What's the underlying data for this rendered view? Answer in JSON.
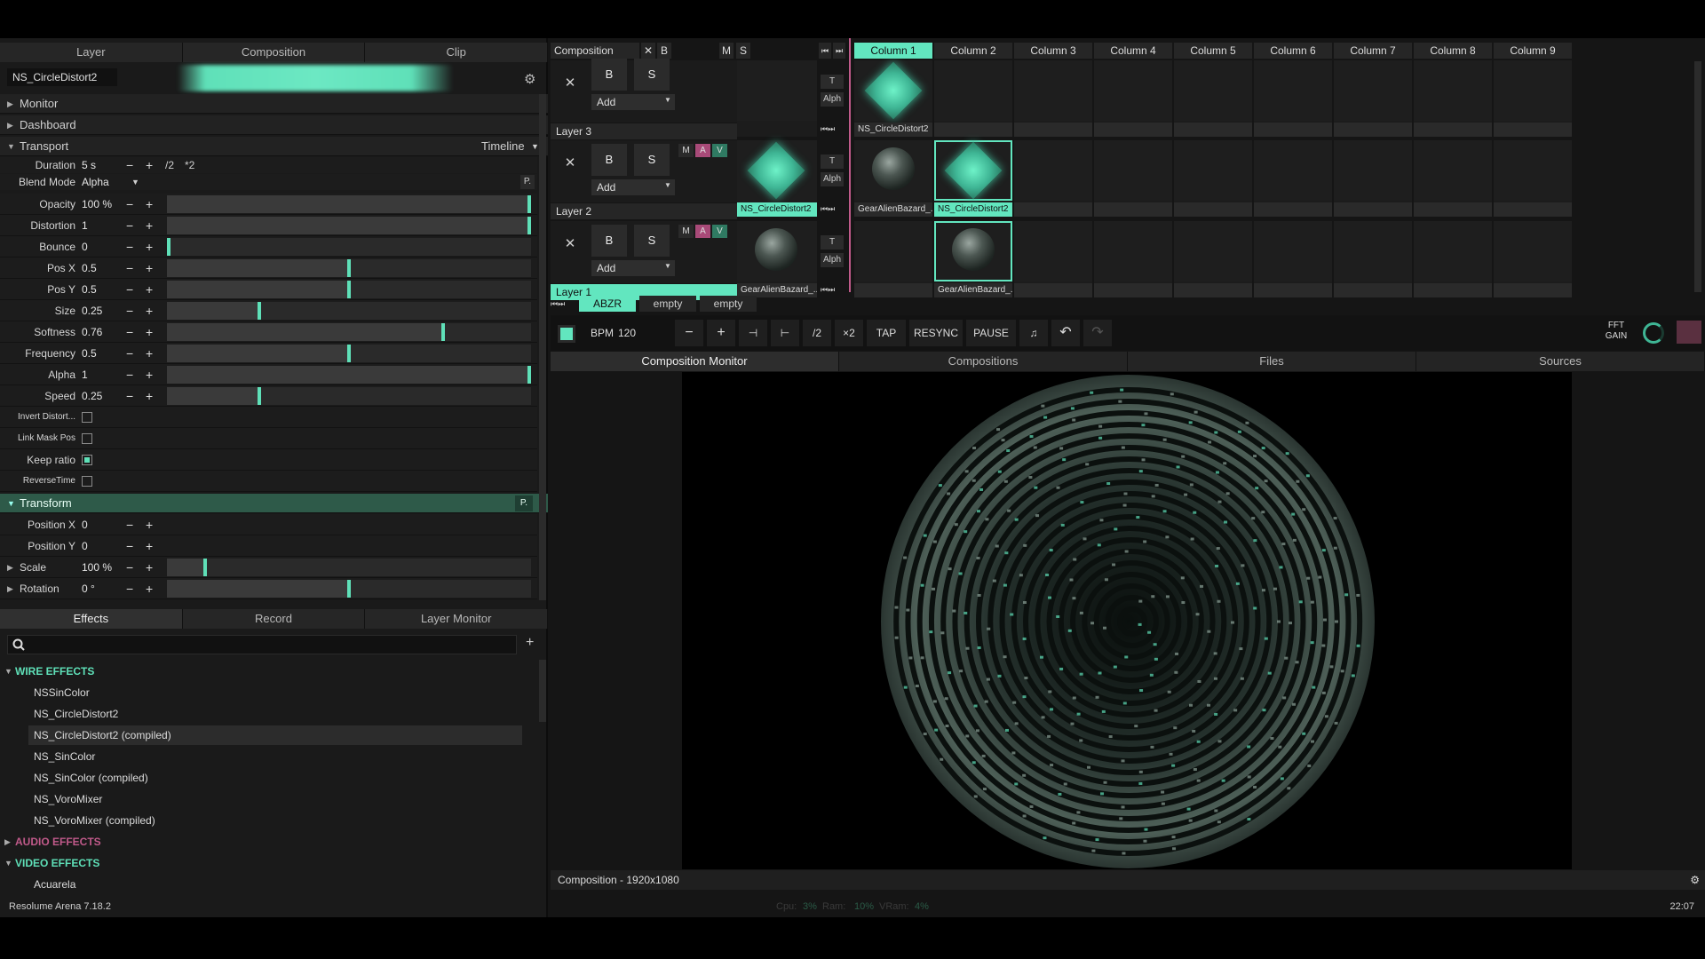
{
  "left_tabs": [
    "Layer",
    "Composition",
    "Clip"
  ],
  "clip_name": "NS_CircleDistort2",
  "sections": {
    "monitor": "Monitor",
    "dashboard": "Dashboard",
    "transport": "Transport",
    "transform": "Transform"
  },
  "transport_mode": "Timeline",
  "transform_p": "P.",
  "blend_p": "P.",
  "duration": {
    "label": "Duration",
    "value": "5 s",
    "minus": "−",
    "plus": "+",
    "half": "/2",
    "double": "*2"
  },
  "blend": {
    "label": "Blend Mode",
    "value": "Alpha"
  },
  "params": [
    {
      "label": "Opacity",
      "value": "100 %",
      "level": 1.0
    },
    {
      "label": "Distortion",
      "value": "1",
      "level": 1.0
    },
    {
      "label": "Bounce",
      "value": "0",
      "level": 0.0
    },
    {
      "label": "Pos X",
      "value": "0.5",
      "level": 0.5
    },
    {
      "label": "Pos Y",
      "value": "0.5",
      "level": 0.5
    },
    {
      "label": "Size",
      "value": "0.25",
      "level": 0.25
    },
    {
      "label": "Softness",
      "value": "0.76",
      "level": 0.76
    },
    {
      "label": "Frequency",
      "value": "0.5",
      "level": 0.5
    },
    {
      "label": "Alpha",
      "value": "1",
      "level": 1.0
    },
    {
      "label": "Speed",
      "value": "0.25",
      "level": 0.25
    }
  ],
  "checks": [
    {
      "label": "Invert Distort...",
      "checked": false
    },
    {
      "label": "Link Mask Pos",
      "checked": false
    },
    {
      "label": "Keep ratio",
      "checked": true
    },
    {
      "label": "ReverseTime",
      "checked": false
    }
  ],
  "transform_params": [
    {
      "label": "Position X",
      "value": "0"
    },
    {
      "label": "Position Y",
      "value": "0"
    },
    {
      "label": "Scale",
      "value": "100 %",
      "level": 0.1
    },
    {
      "label": "Rotation",
      "value": "0 °",
      "level": 0.5
    }
  ],
  "bottom_tabs": [
    "Effects",
    "Record",
    "Layer Monitor"
  ],
  "search_placeholder": "",
  "wire_effects": {
    "title": "WIRE EFFECTS",
    "color": "#5fe0b8",
    "items": [
      "NSSinColor",
      "NS_CircleDistort2",
      "NS_CircleDistort2 (compiled)",
      "NS_SinColor",
      "NS_SinColor (compiled)",
      "NS_VoroMixer",
      "NS_VoroMixer (compiled)"
    ],
    "selected": "NS_CircleDistort2 (compiled)"
  },
  "audio_effects": {
    "title": "AUDIO EFFECTS",
    "color": "#c05a8a"
  },
  "video_effects": {
    "title": "VIDEO EFFECTS",
    "color": "#5fe0b8",
    "items": [
      "Acuarela"
    ]
  },
  "comp": {
    "label": "Composition",
    "x": "✕",
    "b": "B",
    "m": "M",
    "s": "S"
  },
  "columns": [
    "Column 1",
    "Column 2",
    "Column 3",
    "Column 4",
    "Column 5",
    "Column 6",
    "Column 7",
    "Column 8",
    "Column 9"
  ],
  "layers": [
    {
      "name": "Layer 3",
      "b": "B",
      "s": "S",
      "x": "✕",
      "add": "Add",
      "t": "T",
      "alph": "Alph"
    },
    {
      "name": "Layer 2",
      "b": "B",
      "s": "S",
      "x": "✕",
      "add": "Add",
      "t": "T",
      "alph": "Alph",
      "m": "M",
      "a": "A",
      "v": "V"
    },
    {
      "name": "Layer 1",
      "b": "B",
      "s": "S",
      "x": "✕",
      "add": "Add",
      "t": "T",
      "alph": "Alph",
      "m": "M",
      "a": "A",
      "v": "V"
    }
  ],
  "clips": {
    "l3_c0": "NS_CircleDistort2",
    "l2_pre": "NS_CircleDistort2",
    "l2_c0": "GearAlienBazard_...",
    "l2_c1": "NS_CircleDistort2",
    "l1_pre": "GearAlienBazard_...",
    "l1_c1": "GearAlienBazard_..."
  },
  "deck_tabs": [
    "ABZR",
    "empty",
    "empty"
  ],
  "transport": {
    "bpm_label": "BPM",
    "bpm": "120",
    "minus": "−",
    "plus": "+",
    "half": "/2",
    "double": "×2",
    "tap": "TAP",
    "resync": "RESYNC",
    "pause": "PAUSE",
    "fft": "FFT",
    "gain": "GAIN"
  },
  "monitor_tabs": [
    "Composition Monitor",
    "Compositions",
    "Files",
    "Sources"
  ],
  "comp_info": "Composition - 1920x1080",
  "app_version": "Resolume Arena 7.18.2",
  "stats": {
    "cpu": "Cpu:",
    "cpu_val": "3%",
    "ram": "Ram:",
    "ram_val": "10%",
    "vram": "VRam:",
    "vram_val": "4%"
  },
  "clock": "22:07",
  "accent": "#62e6bf"
}
